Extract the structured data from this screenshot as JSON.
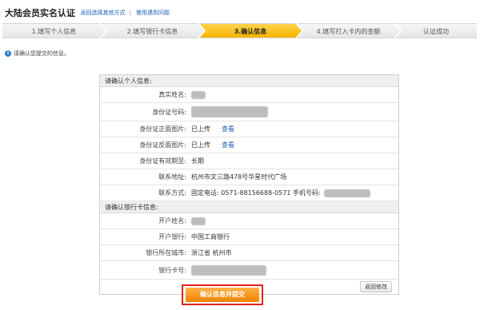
{
  "header": {
    "title": "大陆会员实名认证",
    "link_other": "返回选择其他方式",
    "separator": "|",
    "link_help": "使用遇到问题"
  },
  "steps": [
    {
      "label": "1.填写个人信息",
      "active": false
    },
    {
      "label": "2.填写银行卡信息",
      "active": false
    },
    {
      "label": "3.确认信息",
      "active": true
    },
    {
      "label": "4.填写打入卡内的金额",
      "active": false
    },
    {
      "label": "认证成功",
      "active": false
    }
  ],
  "notice": {
    "icon": "info-icon",
    "text": "请确认您提交的信息。"
  },
  "personal": {
    "section_title": "请确认个人信息:",
    "fields": {
      "name_label": "真实姓名:",
      "id_label": "身份证号码:",
      "front_label": "身份证正面图片:",
      "front_status": "已上传",
      "front_view": "查看",
      "back_label": "身份证反面图片:",
      "back_status": "已上传",
      "back_view": "查看",
      "validity_label": "身份证有效期至:",
      "validity_value": "长期",
      "address_label": "联系地址:",
      "address_value": "杭州市文三路478号华星时代广场",
      "contact_label": "联系方式:",
      "contact_value": "固定电话: 0571-88156688-0571 手机号码:"
    }
  },
  "bank": {
    "section_title": "请确认银行卡信息:",
    "fields": {
      "holder_label": "开户姓名:",
      "bank_label": "开户银行:",
      "bank_value": "中国工商银行",
      "city_label": "银行所在城市:",
      "city_value": "浙江省 杭州市",
      "card_label": "银行卡号:"
    }
  },
  "buttons": {
    "back": "返回修改",
    "submit": "确认信息并提交"
  }
}
